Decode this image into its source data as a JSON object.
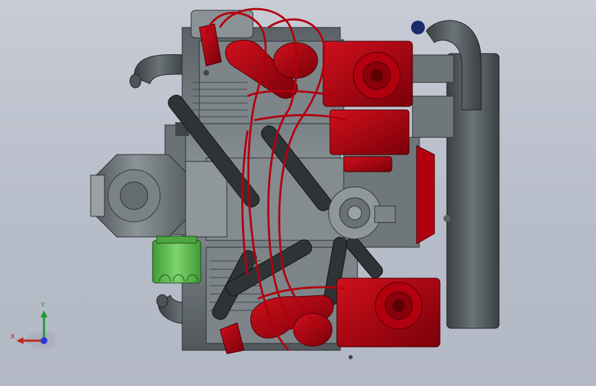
{
  "viewport": {
    "background_top": "#c7ccd6",
    "background_bottom": "#b3b8c5"
  },
  "model": {
    "colors": {
      "red": "#b3000f",
      "red_dark": "#6e0008",
      "grey": "#7c8488",
      "grey_dark": "#4a5054",
      "black": "#2c3033",
      "green": "#5bbf4e"
    }
  },
  "triad": {
    "y_label": "Y",
    "x_label": "X",
    "y_color": "#1f9a2e",
    "x_color": "#c0281d",
    "z_color": "#2c3bd6"
  }
}
